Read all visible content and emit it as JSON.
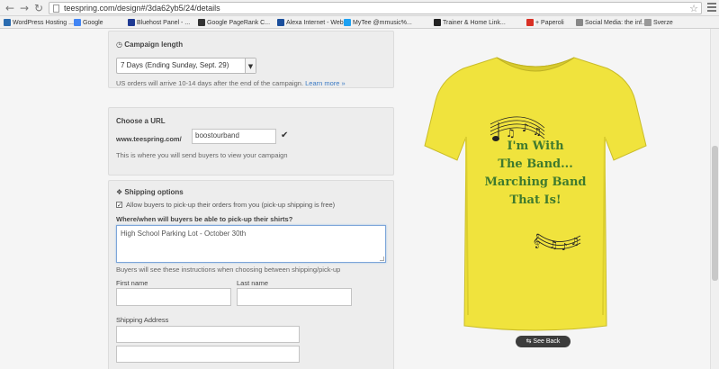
{
  "browser": {
    "url": "teespring.com/design#/3da62yb5/24/details",
    "bookmarks": [
      {
        "label": "WordPress Hosting ...",
        "color": "#2b6cb0"
      },
      {
        "label": "Google",
        "color": "#4285f4"
      },
      {
        "label": "Bluehost Panel - ...",
        "color": "#1f3a93"
      },
      {
        "label": "Google PageRank C...",
        "color": "#333333"
      },
      {
        "label": "Alexa Internet - Web...",
        "color": "#1b4f9c"
      },
      {
        "label": "MyTee @mmusic%...",
        "color": "#1da1f2"
      },
      {
        "label": "Trainer & Home Link...",
        "color": "#222222"
      },
      {
        "label": "+ Paperoli",
        "color": "#d93025"
      },
      {
        "label": "Social Media: the inf...",
        "color": "#888888"
      },
      {
        "label": "Sverze",
        "color": "#999999"
      }
    ]
  },
  "campaign": {
    "title": "Campaign length",
    "selected_length": "7 Days (Ending Sunday, Sept. 29)",
    "note": "US orders will arrive 10-14 days after the end of the campaign.",
    "learn_more": "Learn more »"
  },
  "url_section": {
    "title": "Choose a URL",
    "prefix": "www.teespring.com/",
    "value": "boostourband",
    "help": "This is where you will send buyers to view your campaign"
  },
  "shipping": {
    "title": "Shipping options",
    "pickup_label": "Allow buyers to pick-up their orders from you (pick-up shipping is free)",
    "pickup_checked": "✓",
    "question": "Where/when will buyers be able to pick-up their shirts?",
    "instructions_value": "High School Parking Lot - October 30th",
    "note": "Buyers will see these instructions when choosing between shipping/pick-up",
    "first_name_label": "First name",
    "last_name_label": "Last name",
    "address_label": "Shipping Address"
  },
  "shirt": {
    "color": "#f0e33d",
    "text_lines": [
      "I'm With",
      "The Band...",
      "Marching Band",
      "That Is!"
    ],
    "text_color": "#3f7a2e",
    "see_back_label": "See Back"
  }
}
